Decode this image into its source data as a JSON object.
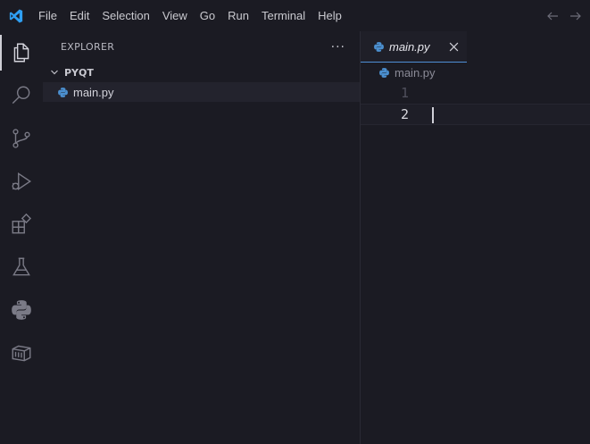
{
  "menu": {
    "items": [
      "File",
      "Edit",
      "Selection",
      "View",
      "Go",
      "Run",
      "Terminal",
      "Help"
    ]
  },
  "activity_bar": {
    "icons": [
      "explorer-icon",
      "search-icon",
      "source-control-icon",
      "run-debug-icon",
      "extensions-icon",
      "testing-icon",
      "python-icon",
      "remote-explorer-icon"
    ],
    "active": "explorer-icon"
  },
  "sidebar": {
    "title": "EXPLORER",
    "more_label": "···",
    "folder": "PYQT",
    "files": [
      {
        "name": "main.py",
        "icon": "python-file-icon"
      }
    ]
  },
  "editor": {
    "tab": {
      "label": "main.py",
      "icon": "python-file-icon"
    },
    "breadcrumb": "main.py",
    "lines": [
      {
        "number": "1",
        "text": ""
      },
      {
        "number": "2",
        "text": ""
      }
    ],
    "current_line": "2"
  },
  "colors": {
    "background": "#1b1b23",
    "accent": "#4f8fd6",
    "vscode_blue": "#2f9ff3",
    "python_blue": "#4b8fcf"
  }
}
